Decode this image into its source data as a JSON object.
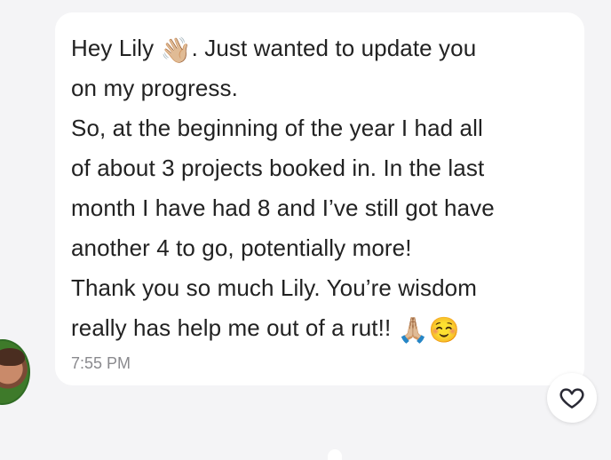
{
  "message": {
    "lines": [
      {
        "before": "Hey Lily ",
        "emoji": "👋🏼",
        "after": ". Just wanted to update you"
      },
      {
        "text": "on my progress."
      },
      {
        "text": "So, at the beginning of the year I had all"
      },
      {
        "text": "of about 3 projects booked in. In the last"
      },
      {
        "text": "month I have had 8 and I’ve still got have"
      },
      {
        "text": "another 4 to go, potentially more!"
      },
      {
        "text": "Thank you so much Lily. You’re wisdom"
      },
      {
        "before": "really has help me out of a rut!! ",
        "emoji": "🙏🏼☺️",
        "after": ""
      }
    ],
    "timestamp": "7:55 PM"
  },
  "icons": {
    "avatar": "avatar",
    "reaction": "heart-icon",
    "wave": "waving-hand-icon",
    "pray": "folded-hands-icon",
    "smile": "smiling-face-icon"
  },
  "colors": {
    "background": "#f4f4f6",
    "bubble": "#ffffff",
    "text": "#222222",
    "timestamp": "#8a8a8e",
    "heart": "#2a2a35"
  }
}
